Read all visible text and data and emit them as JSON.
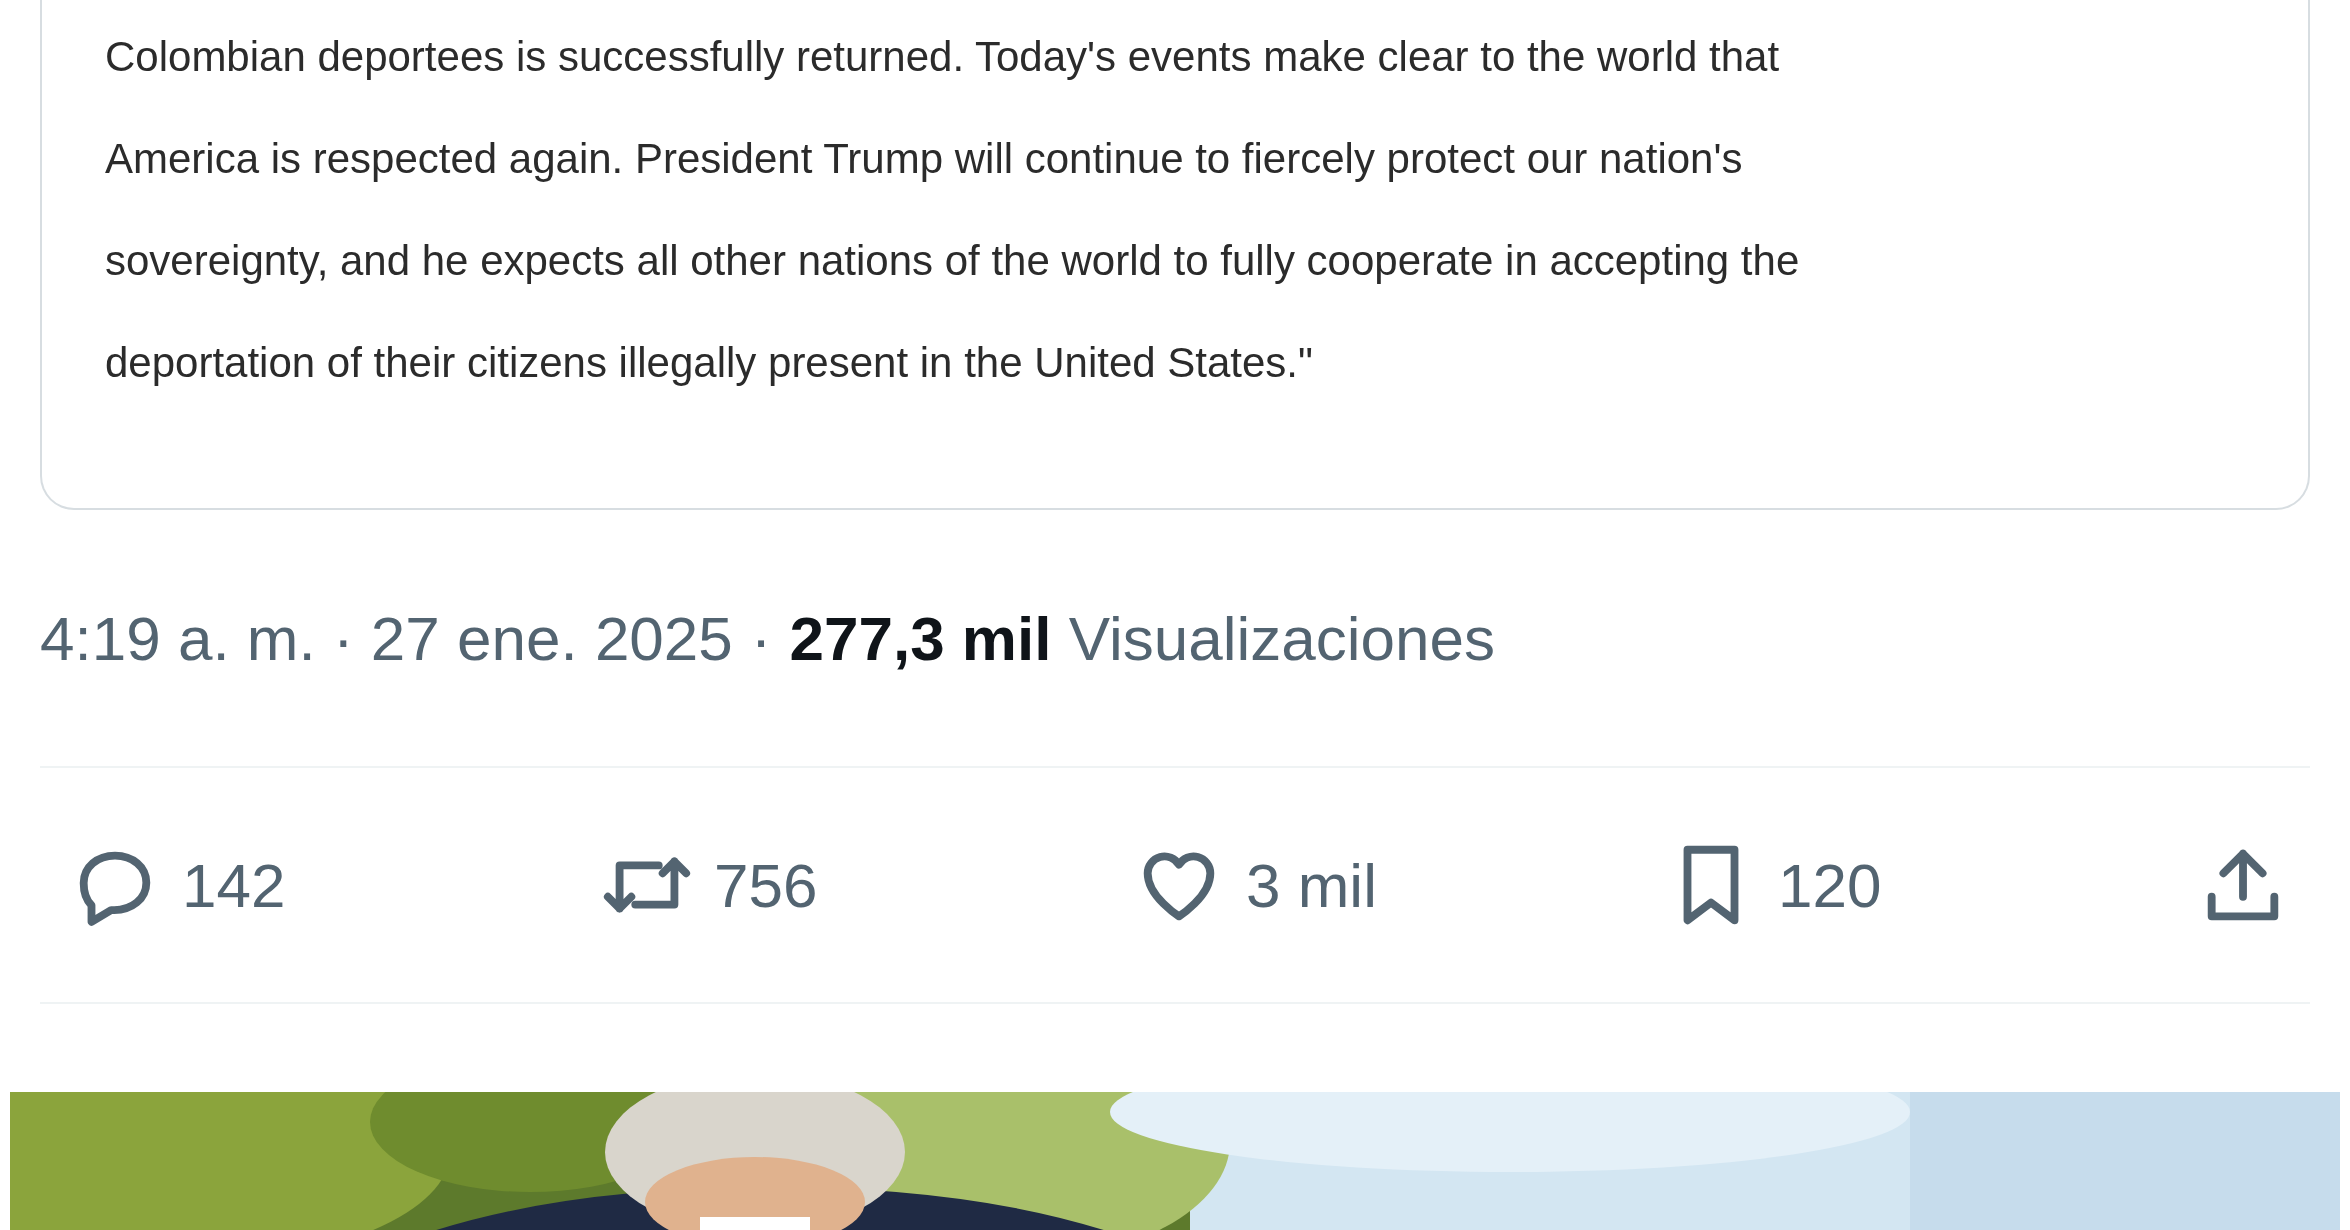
{
  "statement": {
    "lines": [
      "Colombian deportees is successfully returned. Today's events make clear to the world that",
      "America is respected again. President Trump will continue to fiercely protect our nation's",
      "sovereignty, and he expects all other nations of the world to fully cooperate in accepting the",
      "deportation of their citizens illegally present in the United States.\""
    ]
  },
  "timestamp": {
    "time": "4:19 a. m. · 27 ene. 2025",
    "separator": "·",
    "views": "**277,3 mil** Visualizaciones"
  },
  "actions": [
    {
      "kind": "reply",
      "count": "142"
    },
    {
      "kind": "repost",
      "count": "756"
    },
    {
      "kind": "like",
      "count": "3 mil"
    },
    {
      "kind": "bookmark",
      "count": "120"
    },
    {
      "kind": "share"
    }
  ]
}
